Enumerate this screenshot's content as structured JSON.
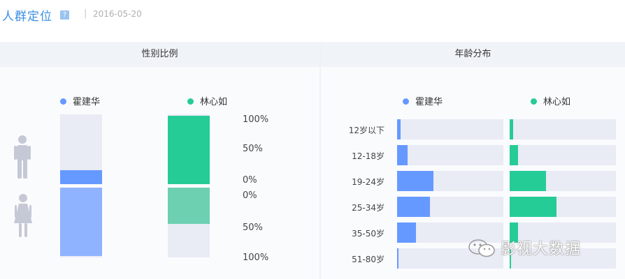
{
  "header": {
    "title": "人群定位",
    "help_icon_glyph": "?",
    "separator": "|",
    "date": "2016-05-20"
  },
  "gender_panel": {
    "title": "性别比例",
    "legend": [
      {
        "name": "霍建华",
        "color": "#6699ff"
      },
      {
        "name": "林心如",
        "color": "#26cc96"
      }
    ],
    "percent_labels_top": [
      "100%",
      "50%",
      "0%"
    ],
    "percent_labels_bottom": [
      "0%",
      "50%",
      "100%"
    ],
    "icons": [
      "male-figure-icon",
      "female-figure-icon"
    ],
    "bars": [
      {
        "person": "霍建华",
        "male_fraction": 0.2,
        "female_fraction": 0.98,
        "male_color": "#6699ff",
        "female_color": "#8fb3ff"
      },
      {
        "person": "林心如",
        "male_fraction": 0.98,
        "female_fraction": 0.52,
        "male_color": "#26cc96",
        "female_color": "#6dd0b1"
      }
    ]
  },
  "age_panel": {
    "title": "年龄分布",
    "legend": [
      {
        "name": "霍建华",
        "color": "#6699ff"
      },
      {
        "name": "林心如",
        "color": "#26cc96"
      }
    ],
    "groups": [
      "12岁以下",
      "12-18岁",
      "19-24岁",
      "25-34岁",
      "35-50岁",
      "51-80岁"
    ],
    "series": [
      {
        "name": "霍建华",
        "color": "#6699ff",
        "fractions": [
          0.03,
          0.1,
          0.34,
          0.31,
          0.18,
          0.01
        ]
      },
      {
        "name": "林心如",
        "color": "#26cc96",
        "fractions": [
          0.03,
          0.08,
          0.34,
          0.44,
          0.08,
          0.01
        ]
      }
    ]
  },
  "watermark": {
    "text": "影视大数据",
    "icon": "wechat-logo-icon"
  }
}
